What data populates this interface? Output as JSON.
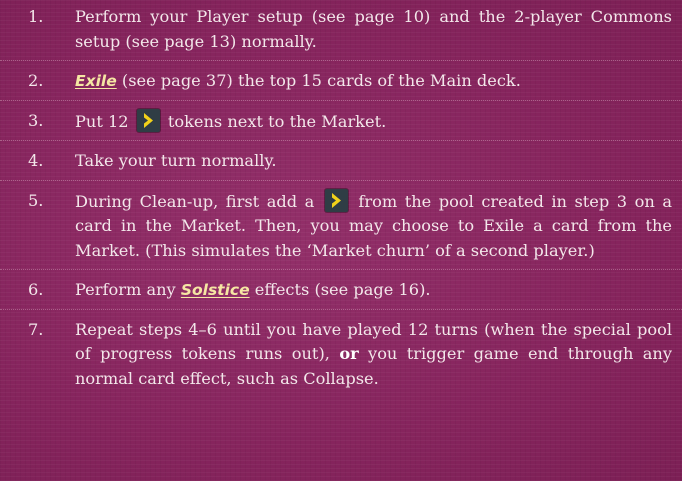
{
  "steps": [
    {
      "num": "1.",
      "text": "Perform your Player setup (see page 10) and the 2-player Commons setup (see page 13) normally."
    },
    {
      "num": "2.",
      "keyword": "Exile",
      "text_after": " (see page 37) the top 15 cards of the Main deck."
    },
    {
      "num": "3.",
      "text_before": "Put 12 ",
      "icon": "progress-token-icon",
      "text_after": " tokens next to the Market."
    },
    {
      "num": "4.",
      "text": "Take your turn normally."
    },
    {
      "num": "5.",
      "text_before": "During Clean-up, first add a ",
      "icon": "progress-token-icon",
      "text_after": " from the pool created in step 3 on a card in the Market. Then, you may choose to Exile a card from the Market. (This simulates the ‘Market churn’ of a second player.)"
    },
    {
      "num": "6.",
      "text_before": "Perform any ",
      "keyword": "Solstice",
      "text_after": " effects (see page 16)."
    },
    {
      "num": "7.",
      "text_before": "Repeat steps 4–6 until you have played 12 turns (when the special pool of progress tokens runs out), ",
      "bold": "or",
      "text_after": " you trigger game end through any normal card effect, such as Collapse."
    }
  ],
  "colors": {
    "background": "#8a2660",
    "text": "#f3e7ea",
    "keyword": "#f5e6a3",
    "token_bg": "#2f3d45",
    "token_chevron": "#f2d21a"
  }
}
